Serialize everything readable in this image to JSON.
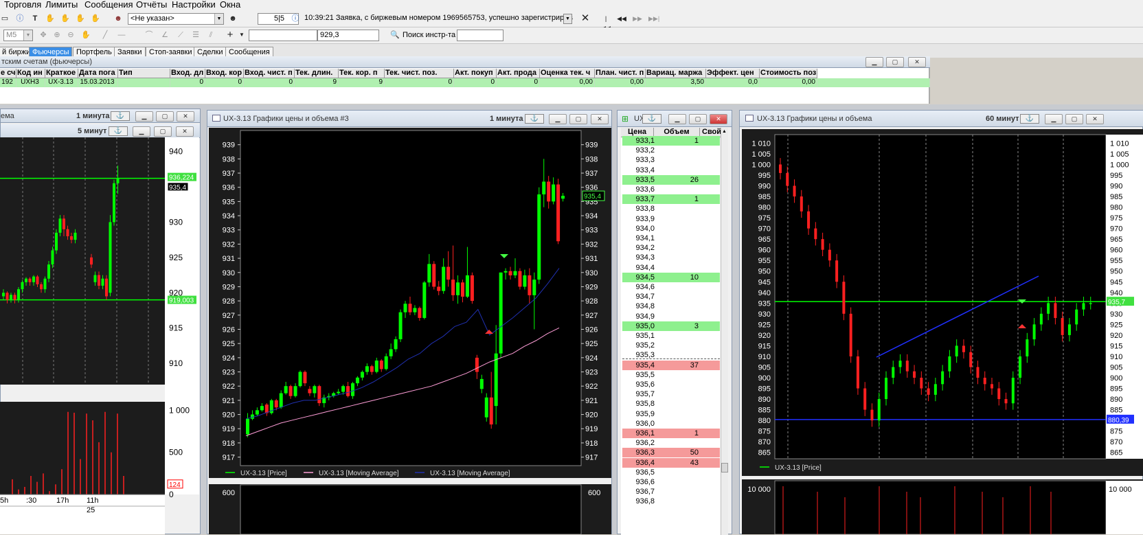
{
  "menu": [
    "Торговля",
    "Лимиты",
    "Сообщения",
    "Отчёты",
    "Настройки",
    "Окна"
  ],
  "toolbar1": {
    "account_select": "<Не указан>",
    "counter": "5|5",
    "message": "10:39:21  Заявка, с биржевым номером 1969565753, успешно зарегистрирова"
  },
  "toolbar2": {
    "interval_select": "M5",
    "price_value": "929,3",
    "search_label": "Поиск инстр-та",
    "search_value": ""
  },
  "tabs": [
    {
      "label": "й биржи",
      "active": false
    },
    {
      "label": "Фьючерсы",
      "active": true
    },
    {
      "label": "Портфель",
      "active": false
    },
    {
      "label": "Заявки",
      "active": false
    },
    {
      "label": "Стоп-заявки",
      "active": false
    },
    {
      "label": "Сделки",
      "active": false
    },
    {
      "label": "Сообщения",
      "active": false
    }
  ],
  "positions_table": {
    "title": "тским счетам (фьючерсы)",
    "headers": [
      "е сче",
      "Код ин",
      "Краткое",
      "Дата пога",
      "Тип",
      "Вход. дл",
      "Вход. кор",
      "Вход. чист. п",
      "Тек. длин.",
      "Тек. кор. п",
      "Тек. чист. поз.",
      "Акт. покуп",
      "Акт. прода",
      "Оценка тек. ч",
      "План. чист. п",
      "Вариац. маржа",
      "Эффект. цен",
      "Стоимость поз"
    ],
    "row": [
      "192",
      "UXH3",
      "UX-3.13",
      "15.03.2013",
      "",
      "0",
      "0",
      "0",
      "9",
      "9",
      "0",
      "0",
      "0",
      "0,00",
      "0,00",
      "3,50",
      "0,0",
      "0,00"
    ]
  },
  "left_chart": {
    "title": "ема",
    "interval": "1 минута",
    "interval2": "5 минут",
    "y_ticks": [
      "940",
      "935",
      "930",
      "925",
      "920",
      "915",
      "910"
    ],
    "price_badge_1": "936,224",
    "price_badge_2": "935,4",
    "price_badge_3": "919,003",
    "vol_ticks": [
      "1 000",
      "500",
      "0"
    ],
    "vol_badge": "124",
    "time_ticks": [
      "5h",
      ":30",
      "17h",
      "11h"
    ],
    "date_tick": "25"
  },
  "chart3": {
    "title": "UX-3.13 Графики цены и объема #3",
    "interval": "1 минута",
    "price_badge": "935,4",
    "legend": [
      "UX-3.13 [Price]",
      "UX-3.13 [Moving Average]",
      "UX-3.13 [Moving Average]"
    ],
    "vol_tick": "600"
  },
  "orderbook": {
    "title": "UX",
    "headers": [
      "Цена",
      "Объем",
      "Свой"
    ],
    "rows": [
      {
        "price": "933,1",
        "vol": "1",
        "type": "buy"
      },
      {
        "price": "933,2",
        "vol": "",
        "type": ""
      },
      {
        "price": "933,3",
        "vol": "",
        "type": ""
      },
      {
        "price": "933,4",
        "vol": "",
        "type": ""
      },
      {
        "price": "933,5",
        "vol": "26",
        "type": "buy"
      },
      {
        "price": "933,6",
        "vol": "",
        "type": ""
      },
      {
        "price": "933,7",
        "vol": "1",
        "type": "buy"
      },
      {
        "price": "933,8",
        "vol": "",
        "type": ""
      },
      {
        "price": "933,9",
        "vol": "",
        "type": ""
      },
      {
        "price": "934,0",
        "vol": "",
        "type": ""
      },
      {
        "price": "934,1",
        "vol": "",
        "type": ""
      },
      {
        "price": "934,2",
        "vol": "",
        "type": ""
      },
      {
        "price": "934,3",
        "vol": "",
        "type": ""
      },
      {
        "price": "934,4",
        "vol": "",
        "type": ""
      },
      {
        "price": "934,5",
        "vol": "10",
        "type": "buy"
      },
      {
        "price": "934,6",
        "vol": "",
        "type": ""
      },
      {
        "price": "934,7",
        "vol": "",
        "type": ""
      },
      {
        "price": "934,8",
        "vol": "",
        "type": ""
      },
      {
        "price": "934,9",
        "vol": "",
        "type": ""
      },
      {
        "price": "935,0",
        "vol": "3",
        "type": "buy"
      },
      {
        "price": "935,1",
        "vol": "",
        "type": ""
      },
      {
        "price": "935,2",
        "vol": "",
        "type": ""
      },
      {
        "price": "935,3",
        "vol": "",
        "type": ""
      },
      {
        "price": "935,4",
        "vol": "37",
        "type": "sell"
      },
      {
        "price": "935,5",
        "vol": "",
        "type": ""
      },
      {
        "price": "935,6",
        "vol": "",
        "type": ""
      },
      {
        "price": "935,7",
        "vol": "",
        "type": ""
      },
      {
        "price": "935,8",
        "vol": "",
        "type": ""
      },
      {
        "price": "935,9",
        "vol": "",
        "type": ""
      },
      {
        "price": "936,0",
        "vol": "",
        "type": ""
      },
      {
        "price": "936,1",
        "vol": "1",
        "type": "sell"
      },
      {
        "price": "936,2",
        "vol": "",
        "type": ""
      },
      {
        "price": "936,3",
        "vol": "50",
        "type": "sell"
      },
      {
        "price": "936,4",
        "vol": "43",
        "type": "sell"
      },
      {
        "price": "936,5",
        "vol": "",
        "type": ""
      },
      {
        "price": "936,6",
        "vol": "",
        "type": ""
      },
      {
        "price": "936,7",
        "vol": "",
        "type": ""
      },
      {
        "price": "936,8",
        "vol": "",
        "type": ""
      }
    ]
  },
  "chart60": {
    "title": "UX-3.13 Графики цены и объема",
    "interval": "60 минут",
    "price_badge": "935,7",
    "price_badge_low": "880,39",
    "legend": "UX-3.13 [Price]",
    "vol_tick": "10 000"
  },
  "colors": {
    "chart_bg": "#1c1c1c",
    "up": "#00ff00",
    "down": "#ff2020",
    "buy_row": "#8ef08e",
    "sell_row": "#f59a9a",
    "accent": "#3a8ee6"
  },
  "chart_data": [
    {
      "type": "candlestick",
      "title": "UX-3.13 Графики цены и объема #3",
      "ylim": [
        916.4,
        940
      ],
      "y_ticks": [
        917,
        918,
        919,
        920,
        921,
        922,
        923,
        924,
        925,
        926,
        927,
        928,
        929,
        930,
        931,
        932,
        933,
        934,
        935,
        936,
        937,
        938,
        939
      ],
      "candles": [
        [
          918.6,
          919.7,
          918.4,
          920.1
        ],
        [
          919.7,
          920.0,
          919.6,
          920.3
        ],
        [
          920.0,
          920.3,
          919.9,
          920.5
        ],
        [
          920.3,
          920.6,
          920.2,
          920.8
        ],
        [
          920.7,
          920.1,
          919.9,
          920.8
        ],
        [
          920.1,
          921.0,
          920.0,
          921.1
        ],
        [
          921.0,
          920.5,
          920.3,
          921.1
        ],
        [
          920.5,
          921.5,
          920.4,
          921.7
        ],
        [
          921.5,
          922.0,
          921.4,
          922.3
        ],
        [
          922.0,
          921.3,
          921.1,
          922.1
        ],
        [
          921.3,
          922.0,
          921.2,
          922.2
        ],
        [
          922.0,
          923.0,
          921.9,
          923.1
        ],
        [
          923.0,
          922.2,
          922.0,
          923.1
        ],
        [
          921.8,
          921.5,
          921.3,
          922.0
        ],
        [
          921.5,
          922.0,
          921.2,
          922.1
        ],
        [
          922.0,
          920.8,
          920.6,
          922.1
        ],
        [
          920.8,
          921.2,
          920.5,
          921.4
        ],
        [
          921.2,
          921.3,
          921.0,
          921.5
        ],
        [
          921.3,
          921.5,
          921.2,
          921.6
        ],
        [
          921.5,
          921.6,
          921.4,
          921.8
        ],
        [
          921.6,
          922.0,
          921.4,
          922.1
        ],
        [
          922.0,
          921.3,
          921.2,
          922.3
        ],
        [
          921.3,
          922.2,
          921.1,
          922.3
        ],
        [
          922.2,
          922.6,
          922.0,
          922.7
        ],
        [
          922.6,
          923.0,
          922.4,
          923.1
        ],
        [
          923.0,
          923.4,
          922.8,
          923.6
        ],
        [
          923.4,
          923.0,
          922.8,
          923.5
        ],
        [
          923.0,
          923.8,
          922.9,
          924.0
        ],
        [
          923.8,
          923.2,
          923.0,
          923.9
        ],
        [
          923.2,
          924.1,
          923.1,
          924.3
        ],
        [
          924.1,
          924.6,
          923.9,
          925.0
        ],
        [
          924.6,
          925.3,
          924.4,
          925.5
        ],
        [
          925.3,
          927.2,
          925.1,
          927.4
        ],
        [
          927.2,
          927.8,
          926.8,
          928.0
        ],
        [
          927.8,
          927.2,
          927.0,
          928.3
        ],
        [
          927.2,
          927.5,
          927.0,
          927.7
        ],
        [
          927.5,
          926.8,
          926.6,
          927.6
        ],
        [
          926.8,
          929.3,
          926.7,
          929.4
        ],
        [
          929.3,
          930.6,
          929.0,
          931.3
        ],
        [
          930.6,
          929.0,
          928.8,
          930.8
        ],
        [
          929.0,
          928.7,
          928.4,
          929.4
        ],
        [
          928.7,
          930.4,
          928.5,
          931.0
        ],
        [
          930.4,
          929.5,
          929.0,
          931.5
        ],
        [
          929.5,
          928.4,
          928.0,
          931.9
        ],
        [
          928.4,
          929.3,
          927.8,
          929.8
        ],
        [
          929.3,
          928.3,
          927.9,
          929.5
        ],
        [
          928.3,
          929.8,
          928.2,
          931.8
        ],
        [
          929.8,
          928.0,
          927.8,
          930.0
        ],
        [
          924.0,
          923.0,
          922.5,
          924.2
        ],
        [
          921.8,
          922.5,
          921.5,
          922.8
        ],
        [
          919.8,
          921.2,
          919.5,
          921.5
        ],
        [
          921.2,
          919.3,
          919.0,
          923.0
        ],
        [
          920.6,
          924.3,
          919.3,
          926.3
        ],
        [
          924.3,
          930.0,
          924.0,
          930.0
        ],
        [
          930.0,
          930.1,
          929.5,
          930.3
        ],
        [
          930.1,
          929.8,
          929.5,
          930.4
        ],
        [
          929.8,
          930.1,
          929.6,
          931.0
        ],
        [
          930.1,
          929.0,
          928.8,
          930.3
        ],
        [
          929.0,
          929.8,
          928.8,
          930.2
        ],
        [
          929.8,
          928.4,
          927.8,
          930.3
        ],
        [
          928.4,
          929.5,
          926.0,
          930.0
        ],
        [
          929.5,
          935.5,
          929.2,
          936.0
        ],
        [
          935.5,
          936.4,
          934.6,
          938.0
        ],
        [
          936.4,
          935.0,
          934.5,
          936.8
        ],
        [
          935.0,
          936.2,
          934.8,
          936.7
        ],
        [
          936.2,
          932.2,
          932.0,
          936.6
        ],
        [
          935.2,
          935.4,
          935.0,
          935.6
        ]
      ],
      "series": [
        {
          "name": "UX-3.13 [Moving Average]",
          "color": "#ff9ed8",
          "values": [
            918.5,
            918.8,
            919.1,
            919.4,
            919.6,
            919.8,
            920.0,
            920.2,
            920.4,
            920.6,
            920.8,
            921.0,
            921.2,
            921.4,
            921.6,
            921.8,
            922.0,
            922.3,
            922.6,
            922.9,
            923.3,
            923.7,
            924.0,
            924.3,
            924.8,
            925.2,
            925.7,
            926.1
          ]
        },
        {
          "name": "UX-3.13 [Moving Average]",
          "color": "#2030b0",
          "values": [
            919.7,
            919.9,
            920.2,
            920.5,
            920.8,
            921.0,
            921.0,
            921.2,
            921.4,
            921.6,
            921.9,
            922.3,
            922.8,
            923.3,
            923.9,
            924.3,
            925.0,
            925.5,
            926.2,
            926.5,
            927.4,
            925.6,
            926.2,
            926.8,
            927.5,
            928.2,
            929.2,
            930.3
          ]
        }
      ]
    },
    {
      "type": "candlestick",
      "title": "UX-3.13 Графики цены и объема",
      "ylim": [
        862,
        1014
      ],
      "y_ticks": [
        865,
        870,
        875,
        880,
        885,
        890,
        895,
        900,
        905,
        910,
        915,
        920,
        925,
        930,
        935,
        940,
        945,
        950,
        955,
        960,
        965,
        970,
        975,
        980,
        985,
        990,
        995,
        1000,
        1005,
        1010
      ],
      "trendline": [
        [
          1276,
          520
        ],
        [
          1512,
          402
        ]
      ],
      "hlines": [
        935.7,
        880.4
      ]
    }
  ]
}
